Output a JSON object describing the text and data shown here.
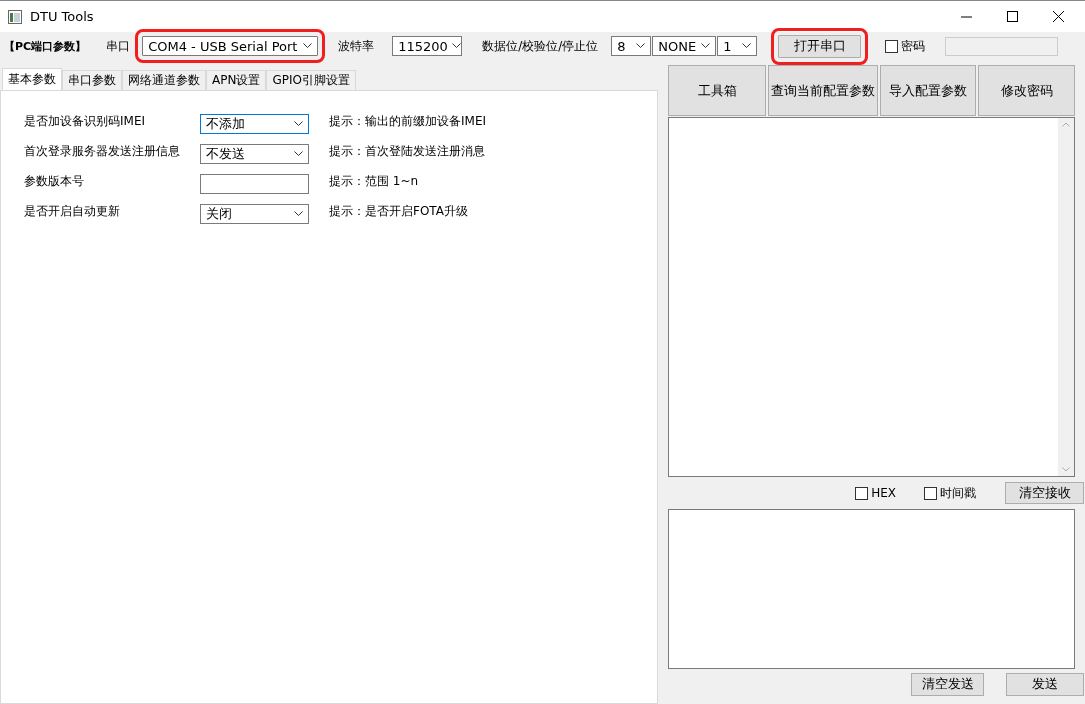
{
  "window": {
    "title": "DTU Tools"
  },
  "port_bar": {
    "section_label": "【PC端口参数】",
    "port_label": "串口",
    "port": {
      "value": "COM4 - USB Serial Port",
      "highlighted": true
    },
    "baud_label": "波特率",
    "baud": "115200",
    "frame_label": "数据位/校验位/停止位",
    "data_bits": "8",
    "parity": "NONE",
    "stop_bits": "1",
    "open_button": {
      "label": "打开串口",
      "highlighted": true
    },
    "password": {
      "label": "密码",
      "checked": false
    }
  },
  "tabs": [
    {
      "label": "基本参数",
      "selected": true
    },
    {
      "label": "串口参数",
      "selected": false
    },
    {
      "label": "网络通道参数",
      "selected": false
    },
    {
      "label": "APN设置",
      "selected": false
    },
    {
      "label": "GPIO引脚设置",
      "selected": false
    }
  ],
  "params": [
    {
      "label": "是否加设备识别码IMEI",
      "kind": "select",
      "value": "不添加",
      "focused": true,
      "hint": "提示：输出的前缀加设备IMEI"
    },
    {
      "label": "首次登录服务器发送注册信息",
      "kind": "select",
      "value": "不发送",
      "focused": false,
      "hint": "提示：首次登陆发送注册消息"
    },
    {
      "label": "参数版本号",
      "kind": "text",
      "focused": false,
      "hint": "提示：范围 1~n"
    },
    {
      "label": "是否开启自动更新",
      "kind": "select",
      "value": "关闭",
      "focused": false,
      "hint": "提示：是否开启FOTA升级"
    }
  ],
  "actions": [
    "工具箱",
    "查询当前配置参数",
    "导入配置参数",
    "修改密码"
  ],
  "receive": {
    "hex": {
      "label": "HEX",
      "checked": false
    },
    "timestamp": {
      "label": "时间戳",
      "checked": false
    },
    "clear_button": "清空接收"
  },
  "send": {
    "clear_button": "清空发送",
    "send_button": "发送"
  }
}
